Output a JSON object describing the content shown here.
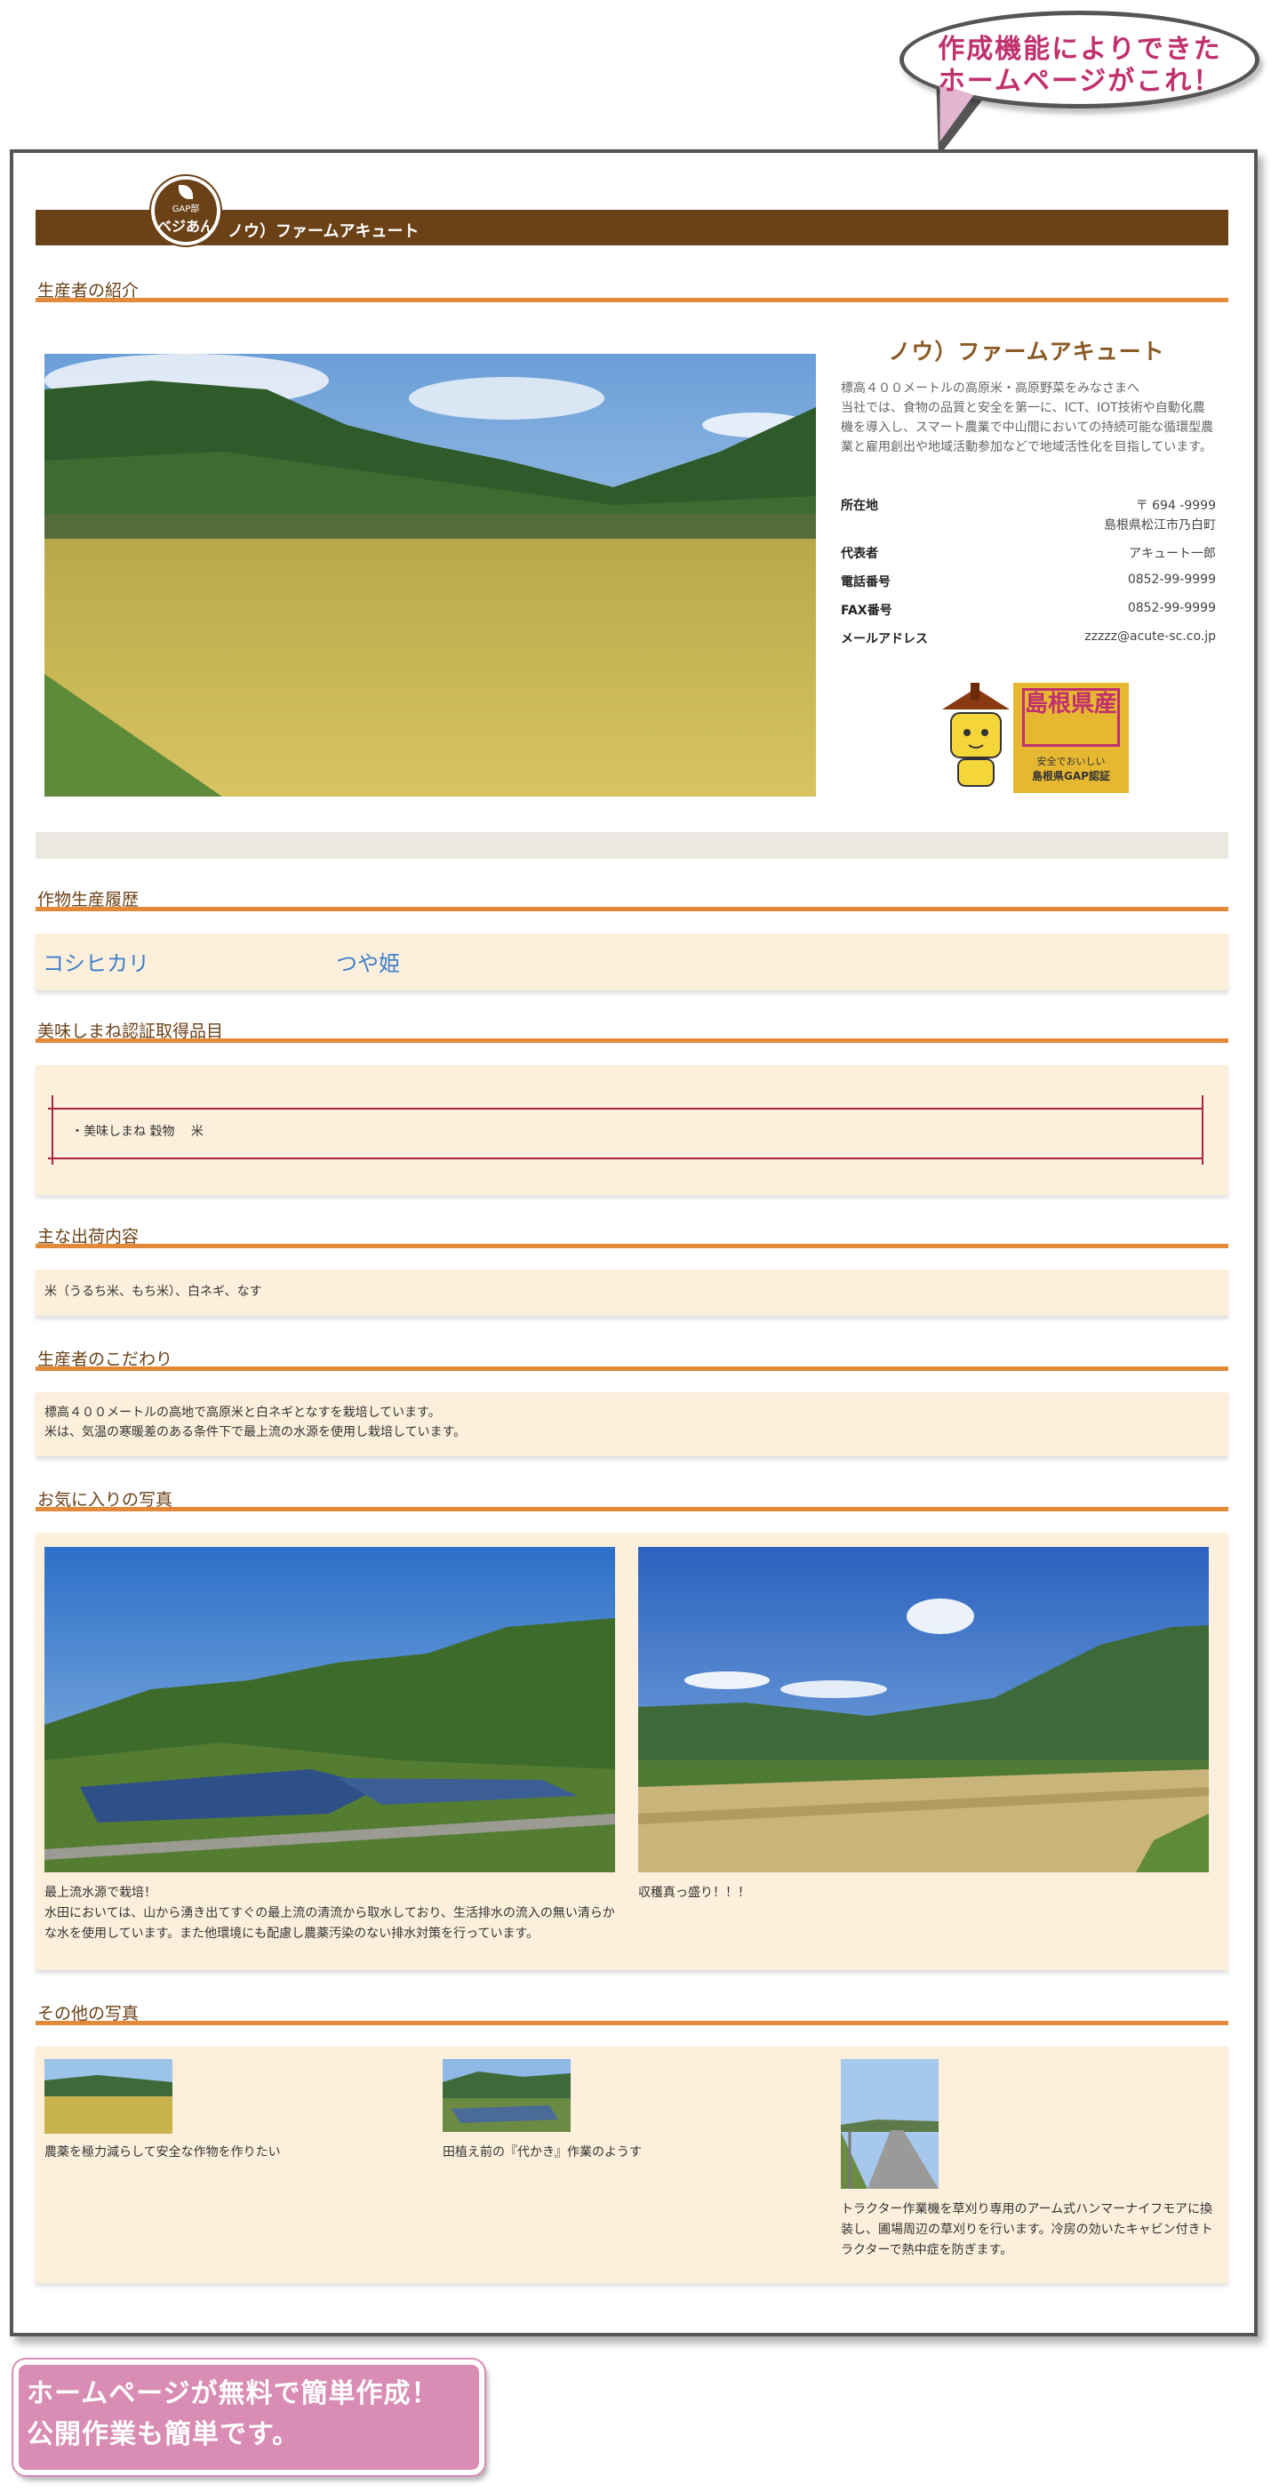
{
  "callout": {
    "line1": "作成機能によりできた",
    "line2": "ホームページがこれ！"
  },
  "header": {
    "logo_top": "GAP部",
    "logo_name": "ベジあん",
    "title": "ノウ）ファームアキュート"
  },
  "sections": {
    "producer": "生産者の紹介",
    "history": "作物生産履歴",
    "certified": "美味しまね認証取得品目",
    "shipments": "主な出荷内容",
    "commitment": "生産者のこだわり",
    "favorites": "お気に入りの写真",
    "others": "その他の写真"
  },
  "producer": {
    "name": "ノウ）ファームアキュート",
    "desc": "標高４００メートルの高原米・高原野菜をみなさまへ\n当社では、食物の品質と安全を第一に、ICT、IOT技術や自動化農機を導入し、スマート農業で中山間においての持続可能な循環型農業と雇用創出や地域活動参加などで地域活性化を目指しています。",
    "info": [
      {
        "label": "所在地",
        "value": "〒 694 -9999",
        "value2": "島根県松江市乃白町"
      },
      {
        "label": "代表者",
        "value": "アキュート一郎"
      },
      {
        "label": "電話番号",
        "value": "0852-99-9999"
      },
      {
        "label": "FAX番号",
        "value": "0852-99-9999"
      },
      {
        "label": "メールアドレス",
        "value": "zzzzz@acute-sc.co.jp"
      }
    ],
    "badge": {
      "title": "島根県産",
      "sub1": "安全でおいしい",
      "sub2": "島根県GAP認証"
    }
  },
  "crops": [
    "コシヒカリ",
    "つや姫"
  ],
  "certified_item": "・美味しまね 穀物　 米",
  "shipments_text": "米（うるち米、もち米）、白ネギ、なす",
  "commitment_text": "標高４００メートルの高地で高原米と白ネギとなすを栽培しています。\n米は、気温の寒暖差のある条件下で最上流の水源を使用し栽培しています。",
  "favorites": [
    {
      "caption": "最上流水源で栽培！\n水田においては、山から湧き出てすぐの最上流の清流から取水しており、生活排水の流入の無い清らかな水を使用しています。また他環境にも配慮し農薬汚染のない排水対策を行っています。"
    },
    {
      "caption": "収穫真っ盛り！！！"
    }
  ],
  "others": [
    {
      "caption": "農薬を極力減らして安全な作物を作りたい"
    },
    {
      "caption": "田植え前の『代かき』作業のようす"
    },
    {
      "caption": "トラクター作業機を草刈り専用のアーム式ハンマーナイフモアに換装し、圃場周辺の草刈りを行います。冷房の効いたキャビン付きトラクターで熱中症を防ぎます。"
    }
  ],
  "promo": {
    "line1": "ホームページが無料で簡単作成！",
    "line2": "公開作業も簡単です。"
  }
}
